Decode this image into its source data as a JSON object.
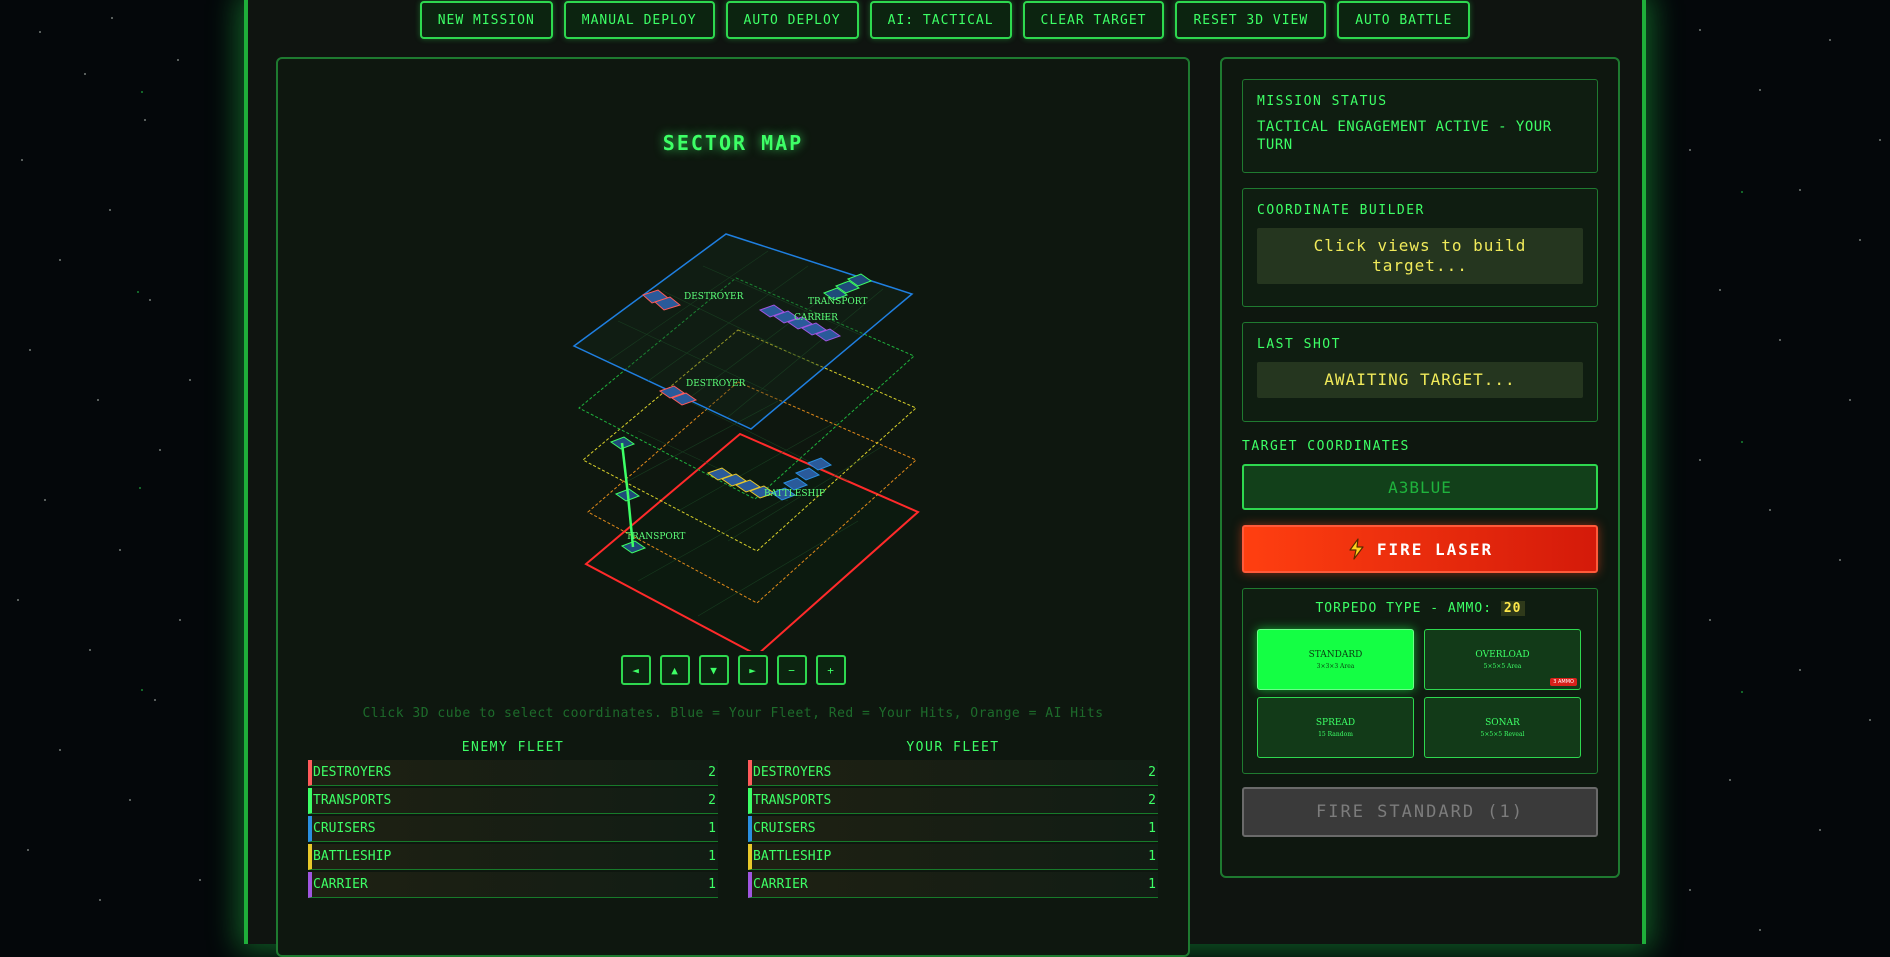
{
  "toolbar": {
    "new_mission": "NEW MISSION",
    "manual_deploy": "MANUAL DEPLOY",
    "auto_deploy": "AUTO DEPLOY",
    "ai_mode": "AI: TACTICAL",
    "clear_target": "CLEAR TARGET",
    "reset_view": "RESET 3D VIEW",
    "auto_battle": "AUTO BATTLE"
  },
  "map": {
    "title": "SECTOR MAP",
    "ship_labels": {
      "destroyer_top": "DESTROYER",
      "transport_top": "TRANSPORT",
      "carrier": "CARRIER",
      "destroyer_mid": "DESTROYER",
      "battleship": "BATTLESHIP",
      "transport_bottom": "TRANSPORT"
    },
    "hint": "Click 3D cube to select coordinates. Blue = Your Fleet, Red = Your Hits, Orange = AI Hits",
    "layer_colors": [
      "#1f7fe0",
      "#1fb33d",
      "#d8d02a",
      "#e08a1a",
      "#ff2a2a"
    ]
  },
  "nav": {
    "left": "◄",
    "up": "▲",
    "down": "▼",
    "right": "►",
    "zoom_out": "−",
    "zoom_in": "+"
  },
  "enemy_fleet": {
    "title": "ENEMY FLEET",
    "rows": [
      {
        "name": "DESTROYERS",
        "count": "2"
      },
      {
        "name": "TRANSPORTS",
        "count": "2"
      },
      {
        "name": "CRUISERS",
        "count": "1"
      },
      {
        "name": "BATTLESHIP",
        "count": "1"
      },
      {
        "name": "CARRIER",
        "count": "1"
      }
    ]
  },
  "your_fleet": {
    "title": "YOUR FLEET",
    "rows": [
      {
        "name": "DESTROYERS",
        "count": "2"
      },
      {
        "name": "TRANSPORTS",
        "count": "2"
      },
      {
        "name": "CRUISERS",
        "count": "1"
      },
      {
        "name": "BATTLESHIP",
        "count": "1"
      },
      {
        "name": "CARRIER",
        "count": "1"
      }
    ]
  },
  "fleet_colors": [
    "#ff5a5a",
    "#3dff66",
    "#2a8fe0",
    "#e8c82a",
    "#a055e0"
  ],
  "panel": {
    "mission_status_label": "MISSION STATUS",
    "mission_status": "TACTICAL ENGAGEMENT ACTIVE - YOUR TURN",
    "coordinate_builder_label": "COORDINATE BUILDER",
    "coordinate_builder": "Click views to build target...",
    "last_shot_label": "LAST SHOT",
    "last_shot": "AWAITING TARGET...",
    "target_coordinates_label": "TARGET COORDINATES",
    "target_value": "A3BLUE",
    "fire_laser": "FIRE LASER",
    "torpedo_label": "TORPEDO TYPE - AMMO:",
    "ammo": "20",
    "torpedoes": [
      {
        "name": "STANDARD",
        "desc": "3×3×3 Area"
      },
      {
        "name": "OVERLOAD",
        "desc": "5×5×5 Area",
        "badge": "3 AMMO"
      },
      {
        "name": "SPREAD",
        "desc": "15 Random"
      },
      {
        "name": "SONAR",
        "desc": "5×5×5 Reveal"
      }
    ],
    "fire_standard": "FIRE STANDARD (1)"
  }
}
